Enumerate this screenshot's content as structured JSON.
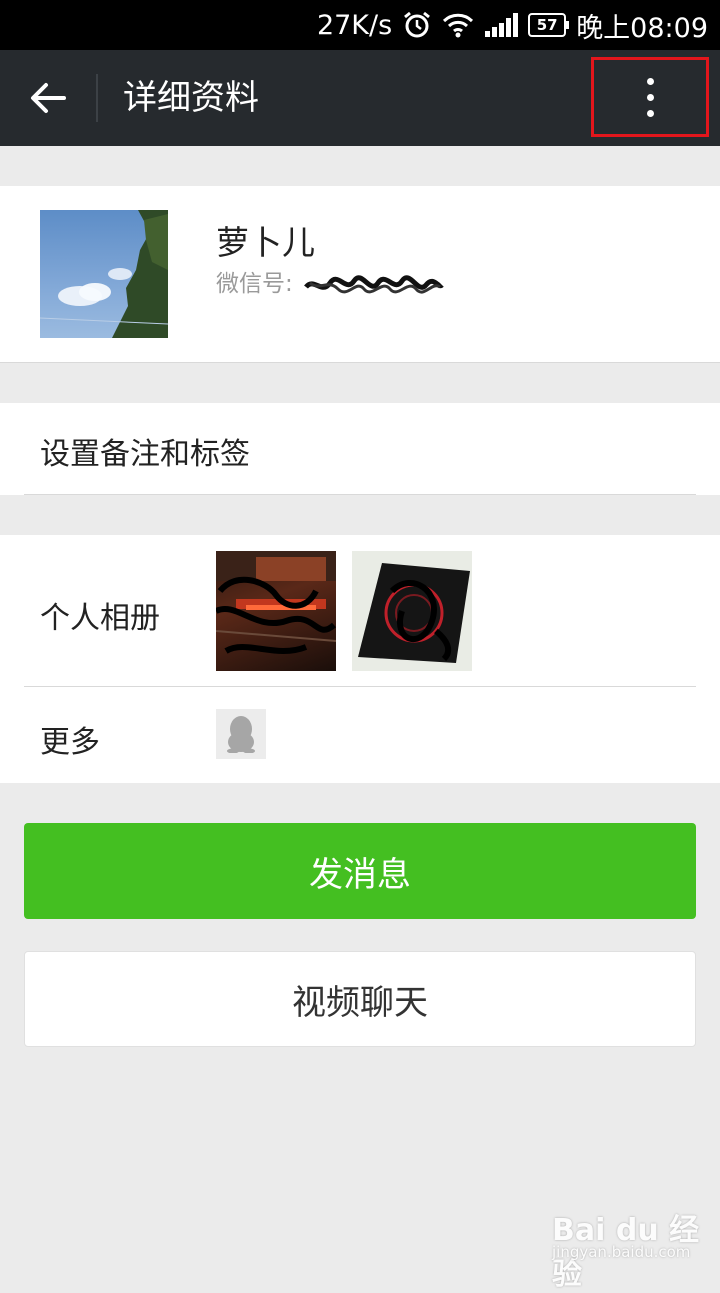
{
  "status_bar": {
    "speed": "27K/s",
    "battery": "57",
    "time": "晚上08:09"
  },
  "nav": {
    "title": "详细资料"
  },
  "profile": {
    "nickname": "萝卜儿",
    "wechat_id_label": "微信号:"
  },
  "remark": {
    "label": "设置备注和标签"
  },
  "album": {
    "label": "个人相册"
  },
  "more": {
    "label": "更多"
  },
  "actions": {
    "send_message": "发消息",
    "video_chat": "视频聊天"
  },
  "watermark": {
    "main": "Bai du 经验",
    "sub": "jingyan.baidu.com"
  },
  "colors": {
    "nav_bg": "#262a2e",
    "primary_green": "#44bf21",
    "highlight_red": "#e3161c",
    "page_bg": "#ebebeb"
  }
}
